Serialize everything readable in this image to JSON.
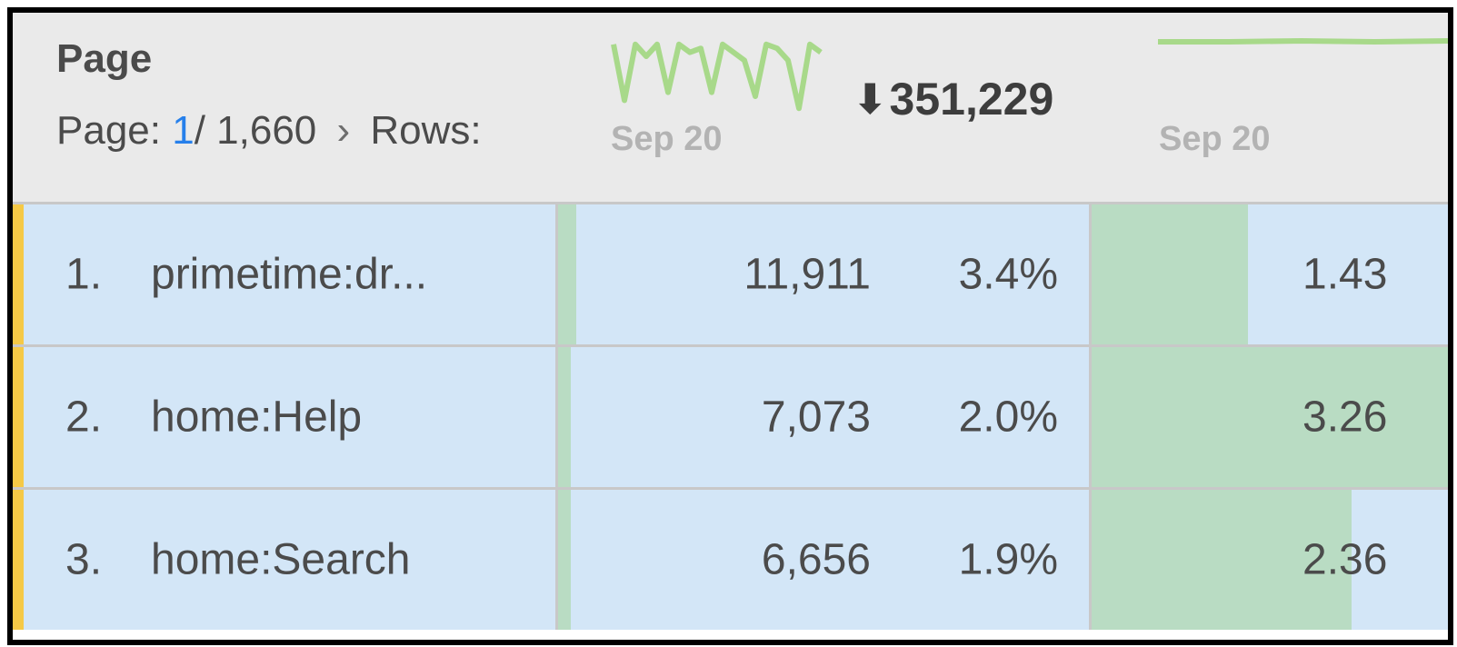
{
  "header": {
    "dimension_title": "Page",
    "pager": {
      "prefix": "Page:",
      "current": "1",
      "total": "/ 1,660",
      "chevron": "›",
      "rows_label": "Rows:"
    },
    "metric1": {
      "sparkline_date": "Sep 20",
      "total_arrow": "⬇",
      "total_value": "351,229",
      "sparkline_values": [
        0.9,
        0.2,
        0.9,
        0.75,
        0.9,
        0.3,
        0.9,
        0.8,
        0.85,
        0.3,
        0.9,
        0.8,
        0.7,
        0.25,
        0.9,
        0.85,
        0.7,
        0.1,
        0.9,
        0.8
      ]
    },
    "metric2": {
      "sparkline_date": "Sep 20"
    }
  },
  "rows": [
    {
      "rank": "1.",
      "page": "primetime:dr...",
      "count": "11,911",
      "percent": "3.4%",
      "metric1_fill": 0.034,
      "metric2_value": "1.43",
      "metric2_fill": 0.44
    },
    {
      "rank": "2.",
      "page": "home:Help",
      "count": "7,073",
      "percent": "2.0%",
      "metric1_fill": 0.02,
      "metric2_value": "3.26",
      "metric2_fill": 1.0
    },
    {
      "rank": "3.",
      "page": "home:Search",
      "count": "6,656",
      "percent": "1.9%",
      "metric1_fill": 0.019,
      "metric2_value": "2.36",
      "metric2_fill": 0.73
    }
  ],
  "colors": {
    "row_bg": "#d3e6f7",
    "bar_green": "#b9dcc3",
    "sparkline_green": "#a8d98a",
    "accent_yellow": "#f5c946",
    "pager_current": "#2680eb"
  }
}
